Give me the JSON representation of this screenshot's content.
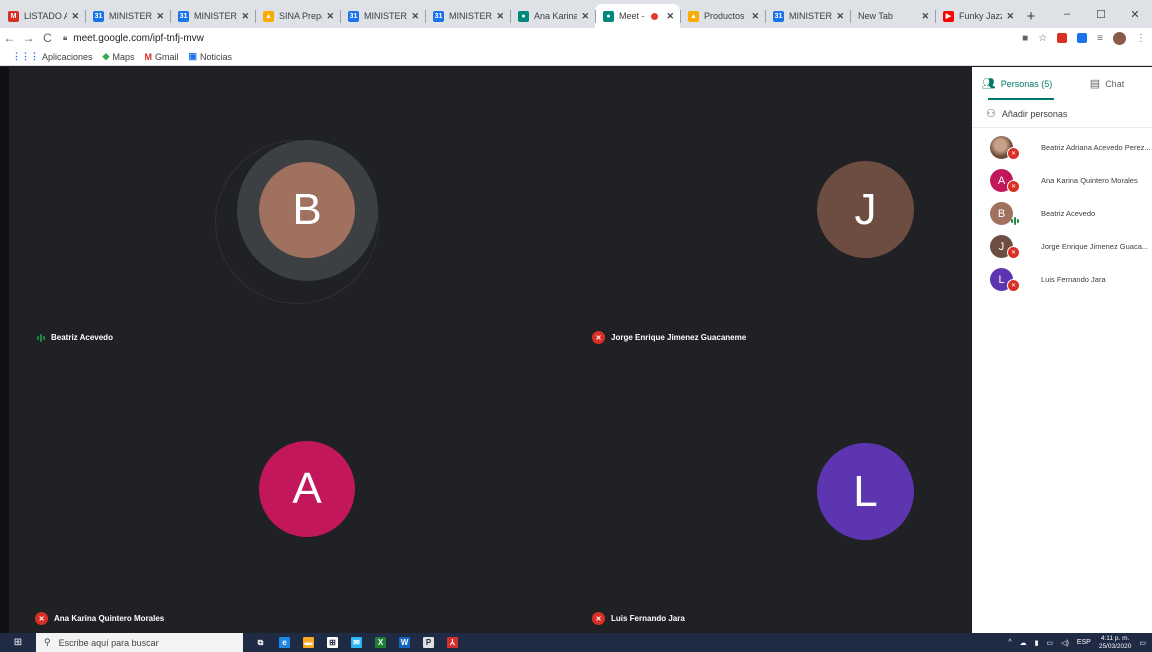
{
  "browser": {
    "tabs": [
      {
        "title": "LISTADO ASIS",
        "favicon": "gmail-icon",
        "color": "#d93025",
        "glyph": "M",
        "active": false
      },
      {
        "title": "MINISTERIO D",
        "favicon": "calendar-icon",
        "color": "#1a73e8",
        "glyph": "31",
        "active": false
      },
      {
        "title": "MINISTERIO D",
        "favicon": "calendar-icon",
        "color": "#1a73e8",
        "glyph": "31",
        "active": false
      },
      {
        "title": "SINA Prepara",
        "favicon": "drive-icon",
        "color": "#f9ab00",
        "glyph": "▲",
        "active": false
      },
      {
        "title": "MINISTERIO D",
        "favicon": "calendar-icon",
        "color": "#1a73e8",
        "glyph": "31",
        "active": false
      },
      {
        "title": "MINISTERIO D",
        "favicon": "calendar-icon",
        "color": "#1a73e8",
        "glyph": "31",
        "active": false
      },
      {
        "title": "Ana Karina, Jo",
        "favicon": "meet-icon",
        "color": "#00897b",
        "glyph": "●",
        "active": false
      },
      {
        "title": "Meet - tnf",
        "favicon": "meet-icon",
        "color": "#00897b",
        "glyph": "●",
        "active": true,
        "recording": true
      },
      {
        "title": "Productos ser",
        "favicon": "drive-icon",
        "color": "#f9ab00",
        "glyph": "▲",
        "active": false
      },
      {
        "title": "MINISTERIO D",
        "favicon": "calendar-icon",
        "color": "#1a73e8",
        "glyph": "31",
        "active": false
      },
      {
        "title": "New Tab",
        "favicon": "",
        "color": "",
        "glyph": "",
        "active": false
      },
      {
        "title": "Funky Jazz • ",
        "favicon": "youtube-icon",
        "color": "#ff0000",
        "glyph": "▶",
        "active": false
      }
    ],
    "new_tab": "+",
    "window_controls": {
      "minimize": "–",
      "maximize": "☐",
      "close": "✕"
    },
    "nav": {
      "back": "←",
      "forward": "→",
      "reload": "C"
    },
    "url": "meet.google.com/ipf-tnfj-mvw",
    "bookmarks": [
      {
        "label": "Aplicaciones",
        "icon": "apps-grid-icon",
        "glyph": "⋮⋮⋮",
        "color": "#1a73e8"
      },
      {
        "label": "Maps",
        "icon": "maps-icon",
        "glyph": "◆",
        "color": "#34a853"
      },
      {
        "label": "Gmail",
        "icon": "gmail-icon",
        "glyph": "M",
        "color": "#d93025"
      },
      {
        "label": "Noticias",
        "icon": "news-icon",
        "glyph": "▣",
        "color": "#1a73e8"
      }
    ]
  },
  "meet": {
    "participants_tiles": [
      {
        "initial": "B",
        "name": "Beatriz Acevedo",
        "color": "#a1715f",
        "status": "speaking"
      },
      {
        "initial": "J",
        "name": "Jorge Enrique Jimenez Guacaneme",
        "color": "#6d4c41",
        "status": "muted"
      },
      {
        "initial": "A",
        "name": "Ana Karina Quintero Morales",
        "color": "#c2185b",
        "status": "muted"
      },
      {
        "initial": "L",
        "name": "Luis Fernando Jara",
        "color": "#5e35b1",
        "status": "muted"
      }
    ],
    "panel": {
      "people_tab": "Personas (5)",
      "chat_tab": "Chat",
      "add_people": "Añadir personas",
      "people": [
        {
          "initial": "",
          "name": "Beatriz Adriana Acevedo Perez...",
          "color": "#8a5a4a",
          "status": "muted",
          "photo": true
        },
        {
          "initial": "A",
          "name": "Ana Karina Quintero Morales",
          "color": "#c2185b",
          "status": "muted"
        },
        {
          "initial": "B",
          "name": "Beatriz Acevedo",
          "color": "#a1715f",
          "status": "speaking"
        },
        {
          "initial": "J",
          "name": "Jorge Enrique Jimenez Guaca...",
          "color": "#6d4c41",
          "status": "muted"
        },
        {
          "initial": "L",
          "name": "Luis Fernando Jara",
          "color": "#5e35b1",
          "status": "muted"
        }
      ]
    }
  },
  "taskbar": {
    "search_placeholder": "Escribe aquí para buscar",
    "apps": [
      {
        "name": "task-view-icon",
        "color": "#1f2a44",
        "glyph": "⧉"
      },
      {
        "name": "edge-icon",
        "color": "#1e88e5",
        "glyph": "e"
      },
      {
        "name": "file-explorer-icon",
        "color": "#f9a825",
        "glyph": "▬"
      },
      {
        "name": "store-icon",
        "color": "#ffffff",
        "glyph": "⊞"
      },
      {
        "name": "mail-icon",
        "color": "#29b6f6",
        "glyph": "✉"
      },
      {
        "name": "excel-icon",
        "color": "#1e7e34",
        "glyph": "X"
      },
      {
        "name": "word-icon",
        "color": "#1565c0",
        "glyph": "W"
      },
      {
        "name": "powerpoint-icon",
        "color": "#e0e0e0",
        "glyph": "P"
      },
      {
        "name": "acrobat-icon",
        "color": "#d32f2f",
        "glyph": "⅄"
      }
    ],
    "tray": {
      "language": "ESP",
      "time": "4:11 p. m.",
      "date": "25/03/2020"
    }
  }
}
